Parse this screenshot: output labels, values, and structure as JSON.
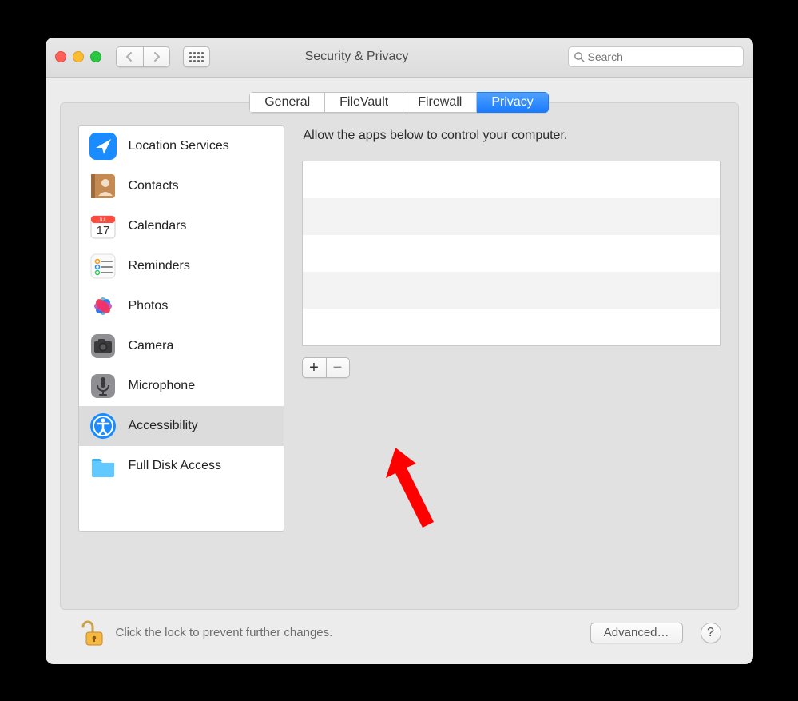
{
  "window": {
    "title": "Security & Privacy"
  },
  "search": {
    "placeholder": "Search"
  },
  "tabs": [
    {
      "label": "General",
      "active": false
    },
    {
      "label": "FileVault",
      "active": false
    },
    {
      "label": "Firewall",
      "active": false
    },
    {
      "label": "Privacy",
      "active": true
    }
  ],
  "sidebar": {
    "items": [
      {
        "label": "Location Services",
        "icon": "location-icon",
        "selected": false
      },
      {
        "label": "Contacts",
        "icon": "contacts-icon",
        "selected": false
      },
      {
        "label": "Calendars",
        "icon": "calendar-icon",
        "selected": false
      },
      {
        "label": "Reminders",
        "icon": "reminders-icon",
        "selected": false
      },
      {
        "label": "Photos",
        "icon": "photos-icon",
        "selected": false
      },
      {
        "label": "Camera",
        "icon": "camera-icon",
        "selected": false
      },
      {
        "label": "Microphone",
        "icon": "microphone-icon",
        "selected": false
      },
      {
        "label": "Accessibility",
        "icon": "accessibility-icon",
        "selected": true
      },
      {
        "label": "Full Disk Access",
        "icon": "folder-icon",
        "selected": false
      }
    ]
  },
  "detail": {
    "hint": "Allow the apps below to control your computer.",
    "apps": [],
    "add_label": "+",
    "remove_label": "−"
  },
  "footer": {
    "lock_message": "Click the lock to prevent further changes.",
    "advanced_label": "Advanced…",
    "help_label": "?"
  },
  "annotation": {
    "arrow_target": "add-app-button",
    "color": "#ff0000"
  }
}
